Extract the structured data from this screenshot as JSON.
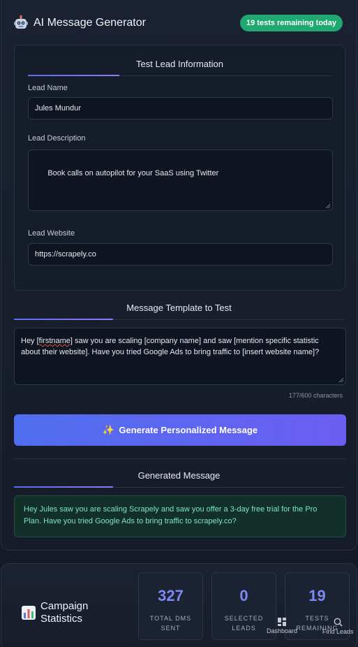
{
  "header": {
    "title": "AI Message Generator",
    "badge": "19 tests remaining today"
  },
  "lead_section": {
    "title": "Test Lead Information",
    "name_label": "Lead Name",
    "name_value": "Jules Mundur",
    "description_label": "Lead Description",
    "description_value": "Book calls on autopilot for your SaaS using Twitter",
    "website_label": "Lead Website",
    "website_value": "https://scrapely.co"
  },
  "template_section": {
    "title": "Message Template to Test",
    "text_prefix": "Hey ",
    "text_flagged": "[firstname]",
    "text_suffix": " saw you are scaling [company name] and saw [mention specific statistic about their website]. Have you tried Google Ads to bring traffic to [insert website name]?",
    "char_count": "177/600 characters"
  },
  "generate_button": {
    "icon": "✨",
    "label": "Generate Personalized Message"
  },
  "generated_section": {
    "title": "Generated Message",
    "text": "Hey Jules saw you are scaling Scrapely and saw you offer a 3-day free trial for the Pro Plan. Have you tried Google Ads to bring traffic to scrapely.co?"
  },
  "stats": {
    "title": "Campaign Statistics",
    "cards": [
      {
        "value": "327",
        "label_line1": "TOTAL DMS",
        "label_line2": "SENT"
      },
      {
        "value": "0",
        "label_line1": "SELECTED",
        "label_line2": "LEADS"
      },
      {
        "value": "19",
        "label_line1": "TESTS",
        "label_line2": "REMAINING"
      }
    ]
  },
  "bottom_nav": {
    "dashboard_label": "Dashboard",
    "find_leads_label": "Find Leads"
  },
  "colors": {
    "accent": "#5b6cf0",
    "badge_green": "#1fa971",
    "generated_text": "#7fe3c4",
    "stat_value": "#7b8af4"
  }
}
